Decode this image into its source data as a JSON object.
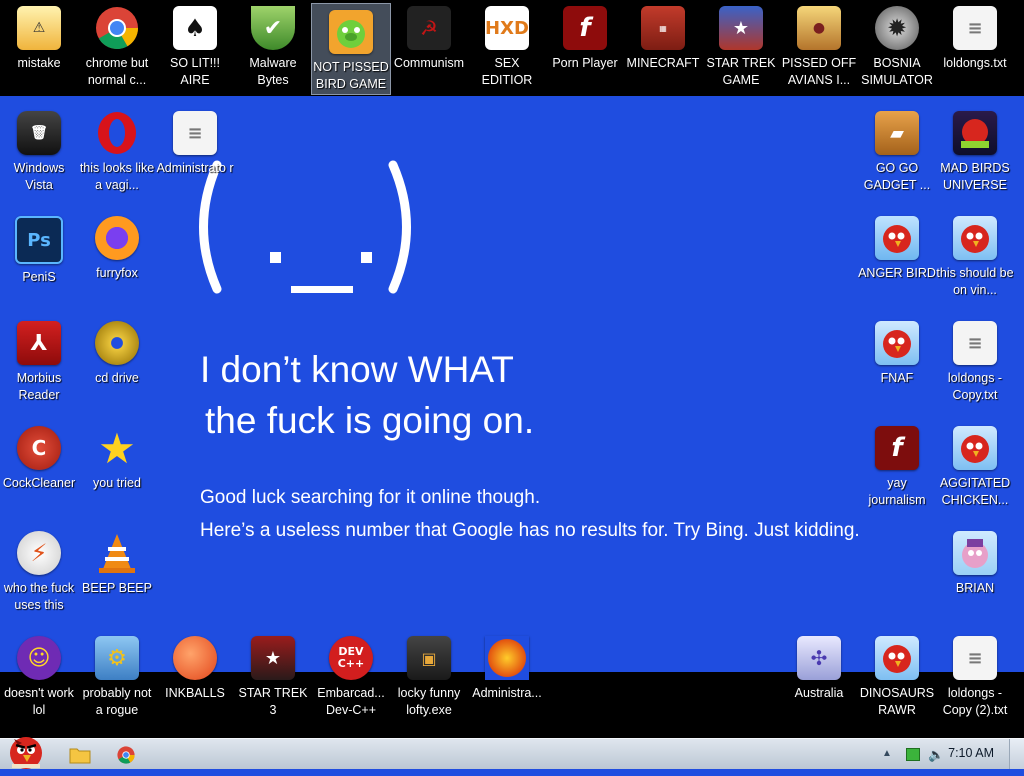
{
  "desktop": {
    "top_row": [
      {
        "label": "mistake"
      },
      {
        "label": "chrome but normal c..."
      },
      {
        "label": "SO LIT!!! AIRE"
      },
      {
        "label": "Malware Bytes"
      },
      {
        "label": "NOT PISSED BIRD GAME"
      },
      {
        "label": "Communism"
      },
      {
        "label": "SEX EDITIOR"
      },
      {
        "label": "Porn Player"
      },
      {
        "label": "MINECRAFT"
      },
      {
        "label": "STAR TREK GAME"
      },
      {
        "label": "PISSED OFF AVIANS I..."
      },
      {
        "label": "BOSNIA SIMULATOR"
      },
      {
        "label": "loldongs.txt"
      }
    ],
    "left_col1": [
      {
        "label": "Windows Vista"
      },
      {
        "label": "PeniS"
      },
      {
        "label": "Morbius Reader"
      },
      {
        "label": "CockCleaner"
      },
      {
        "label": "who the fuck uses this"
      },
      {
        "label": "doesn't work lol"
      }
    ],
    "left_col2": [
      {
        "label": "this looks like a vagi..."
      },
      {
        "label": "furryfox"
      },
      {
        "label": "cd drive"
      },
      {
        "label": "you tried"
      },
      {
        "label": "BEEP BEEP"
      },
      {
        "label": "probably not a rogue"
      }
    ],
    "left_col3": [
      {
        "label": "Administrato r"
      }
    ],
    "bottom_row": [
      {
        "label": "INKBALLS"
      },
      {
        "label": "STAR TREK 3"
      },
      {
        "label": "Embarcad... Dev-C++"
      },
      {
        "label": "locky funny lofty.exe"
      },
      {
        "label": "Administra..."
      }
    ],
    "right_col1": [
      {
        "label": "GO GO GADGET ..."
      },
      {
        "label": "ANGER BIRD"
      },
      {
        "label": "FNAF"
      },
      {
        "label": "yay journalism"
      },
      {
        "label": "Australia"
      },
      {
        "label": "DINOSAURS RAWR"
      }
    ],
    "right_col2": [
      {
        "label": "MAD BIRDS UNIVERSE"
      },
      {
        "label": "this should be on vin..."
      },
      {
        "label": "loldongs - Copy.txt"
      },
      {
        "label": "AGGITATED CHICKEN..."
      },
      {
        "label": "BRIAN"
      },
      {
        "label": "loldongs - Copy (2).txt"
      }
    ]
  },
  "wallpaper": {
    "face": "( ._. )",
    "message_line1": "I don’t know WHAT",
    "message_line2": "the fuck is going on.",
    "sub_line1": "Good luck searching for it online though.",
    "sub_line2": "Here’s a useless number that Google has no results for. Try Bing. Just kidding."
  },
  "taskbar": {
    "clock": "7:10 AM",
    "pinned": [
      "folder-icon",
      "chrome-icon"
    ]
  },
  "colors": {
    "desktop_bg": "#1f4de0",
    "band": "#000000",
    "taskbar_top": "#dfe6ee",
    "taskbar_bottom": "#bcc7d4"
  }
}
